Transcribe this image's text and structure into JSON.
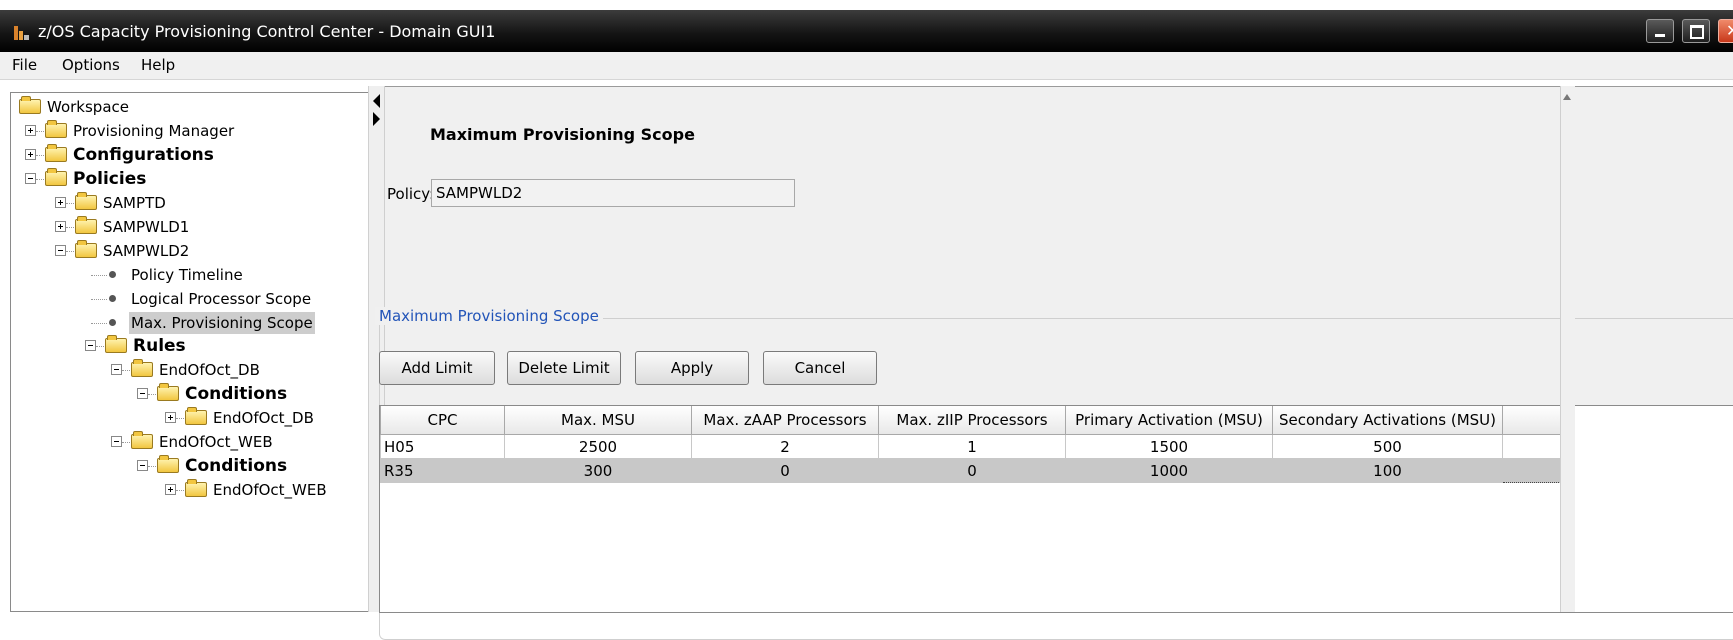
{
  "window": {
    "title": "z/OS Capacity Provisioning Control Center - Domain GUI1"
  },
  "menu": [
    "File",
    "Options",
    "Help"
  ],
  "tree": {
    "root": "Workspace",
    "nodes": [
      {
        "label": "Provisioning Manager"
      },
      {
        "label": "Configurations"
      },
      {
        "label": "Policies"
      },
      {
        "label": "SAMPTD"
      },
      {
        "label": "SAMPWLD1"
      },
      {
        "label": "SAMPWLD2"
      },
      {
        "label": "Policy Timeline"
      },
      {
        "label": "Logical Processor Scope"
      },
      {
        "label": "Max. Provisioning Scope",
        "selected": true
      },
      {
        "label": "Rules"
      },
      {
        "label": "EndOfOct_DB"
      },
      {
        "label": "Conditions"
      },
      {
        "label": "EndOfOct_DB"
      },
      {
        "label": "EndOfOct_WEB"
      },
      {
        "label": "Conditions"
      },
      {
        "label": "EndOfOct_WEB"
      }
    ]
  },
  "main": {
    "section_title": "Maximum Provisioning Scope",
    "policy_label": "Policy:",
    "policy_value": "SAMPWLD2",
    "group_title": "Maximum Provisioning Scope",
    "buttons": {
      "add": "Add Limit",
      "delete": "Delete Limit",
      "apply": "Apply",
      "cancel": "Cancel"
    },
    "table": {
      "headers": [
        "CPC",
        "Max. MSU",
        "Max. zAAP Processors",
        "Max. zIIP Processors",
        "Primary Activation (MSU)",
        "Secondary Activations (MSU)"
      ],
      "rows": [
        [
          "H05",
          "2500",
          "2",
          "1",
          "1500",
          "500"
        ],
        [
          "R35",
          "300",
          "0",
          "0",
          "1000",
          "100"
        ]
      ],
      "selected_row": 1
    }
  }
}
